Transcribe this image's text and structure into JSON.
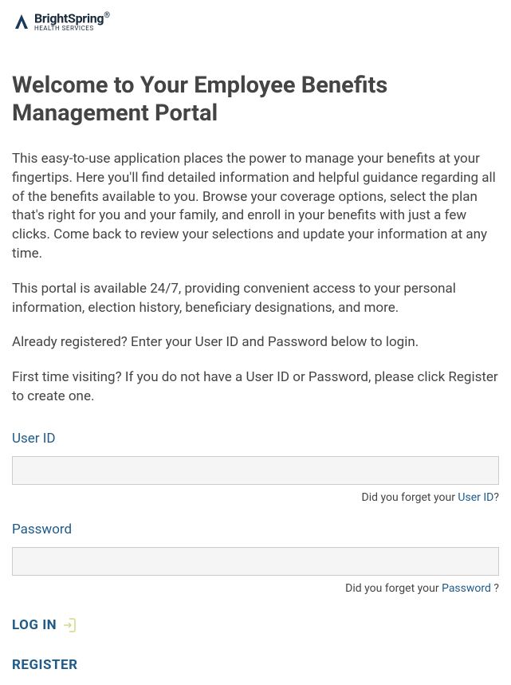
{
  "brand": {
    "name": "BrightSpring",
    "tagline": "HEALTH SERVICES",
    "trademark": "®"
  },
  "header": {
    "title": "Welcome to Your Employee Benefits Management Portal"
  },
  "intro": {
    "p1": "This easy-to-use application places the power to manage your benefits at your fingertips. Here you'll find detailed information and helpful guidance regarding all of the benefits available to you. Browse your coverage options, select the plan that's right for you and your family, and enroll in your benefits with just a few clicks. Come back to review your selections and update your information at any time.",
    "p2": "This portal is available 24/7, providing convenient access to your personal information, election history, beneficiary designations, and more.",
    "p3": "Already registered? Enter your User ID and Password below to login.",
    "p4": "First time visiting? If you do not have a User ID or Password, please click Register to create one."
  },
  "form": {
    "user_id": {
      "label": "User ID",
      "value": "",
      "forgot_prefix": "Did you forget your ",
      "forgot_link": "User ID",
      "forgot_suffix": "?"
    },
    "password": {
      "label": "Password",
      "value": "",
      "forgot_prefix": "Did you forget your ",
      "forgot_link": "Password",
      "forgot_suffix": " ?"
    }
  },
  "actions": {
    "login": "LOG IN",
    "register": "REGISTER"
  }
}
